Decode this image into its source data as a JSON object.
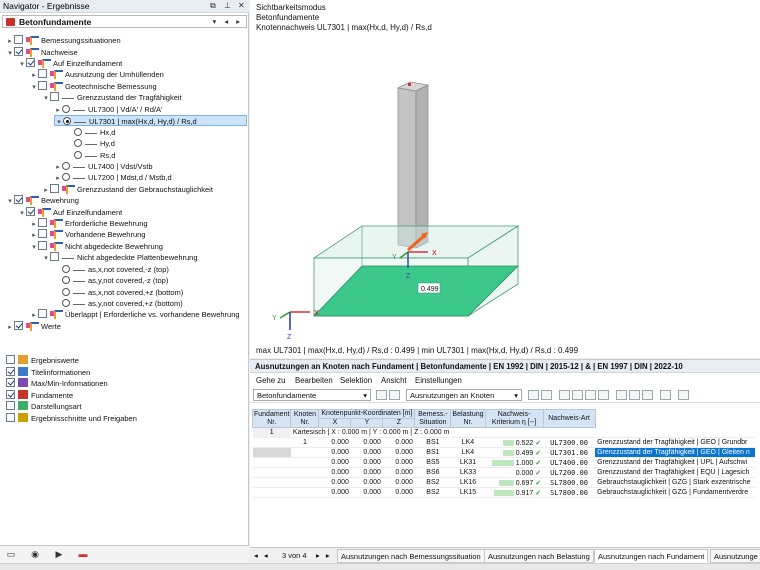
{
  "navigator": {
    "title": "Navigator - Ergebnisse",
    "combo": "Betonfundamente",
    "tree": [
      {
        "label": "Bemessungssituationen"
      },
      {
        "label": "Nachweise"
      },
      {
        "label": "Auf Einzelfundament"
      },
      {
        "label": "Ausnutzung der Umhüllenden"
      },
      {
        "label": "Geotechnische Bemessung"
      },
      {
        "label": "Grenzzustand der Tragfähigkeit"
      },
      {
        "label": "UL7300 | Vd/A' / Rd/A'"
      },
      {
        "label": "UL7301 | max(Hx,d, Hy,d) / Rs,d"
      },
      {
        "label": "Hx,d"
      },
      {
        "label": "Hy,d"
      },
      {
        "label": "Rs,d"
      },
      {
        "label": "UL7400 | Vdst/Vstb"
      },
      {
        "label": "UL7200 | Mdst,d / Mstb,d"
      },
      {
        "label": "Grenzzustand der Gebrauchstauglichkeit"
      },
      {
        "label": "Bewehrung"
      },
      {
        "label": "Auf Einzelfundament"
      },
      {
        "label": "Erforderliche Bewehrung"
      },
      {
        "label": "Vorhandene Bewehrung"
      },
      {
        "label": "Nicht abgedeckte Bewehrung"
      },
      {
        "label": "Nicht abgedeckte Plattenbewehrung"
      },
      {
        "label": "as,x,not covered,-z (top)"
      },
      {
        "label": "as,y,not covered,-z (top)"
      },
      {
        "label": "as,x,not covered,+z (bottom)"
      },
      {
        "label": "as,y,not covered,+z (bottom)"
      },
      {
        "label": "Überlappt | Erforderliche vs. vorhandene Bewehrung"
      },
      {
        "label": "Werte"
      }
    ],
    "bottom_tree": [
      {
        "label": "Ergebniswerte"
      },
      {
        "label": "Titelinformationen"
      },
      {
        "label": "Max/Min-Informationen"
      },
      {
        "label": "Fundamente"
      },
      {
        "label": "Darstellungsart"
      },
      {
        "label": "Ergebnisschnitte und Freigaben"
      }
    ]
  },
  "viewport": {
    "line1": "Sichtbarkeitsmodus",
    "line2": "Betonfundamente",
    "line3": "Knotennachweis UL7301 | max(Hx,d, Hy,d) / Rs,d",
    "value_label": "0.499",
    "axis_x": "X",
    "axis_y": "Y",
    "axis_z": "Z",
    "footer": "max UL7301 | max(Hx,d, Hy,d) / Rs,d : 0.499 | min UL7301 | max(Hx,d, Hy,d) / Rs,d : 0.499",
    "colors": {
      "footing_top": "#3cc88a",
      "footing_edge": "#4a9c7a",
      "column": "#c8c8c8"
    }
  },
  "results": {
    "title": "Ausnutzungen an Knoten nach Fundament | Betonfundamente | EN 1992 | DIN | 2015-12 | & | EN 1997 | DIN | 2022-10",
    "menu": [
      "Gehe zu",
      "Bearbeiten",
      "Selektion",
      "Ansicht",
      "Einstellungen"
    ],
    "combo1": "Betonfundamente",
    "combo2": "Ausnutzungen an Knoten",
    "headers": {
      "fundament": "Fundament Nr.",
      "knoten": "Knoten Nr.",
      "coords": "Knotenpunkt-Koordinaten [m]",
      "x": "X",
      "y": "Y",
      "z": "Z",
      "bemessung": "Bemess.-Situation",
      "belastung": "Belastung Nr.",
      "kriterium": "Nachweis-Kriterium η [--]",
      "art": "Nachweis-Art"
    },
    "group_label": "1",
    "group_text": "Kartesisch | X : 0.000 m | Y : 0.000 m | Z : 0.000 m",
    "rows": [
      {
        "knoten": "1",
        "x": "0.000",
        "y": "0.000",
        "z": "0.000",
        "bs": "BS1",
        "lk": "LK4",
        "eta": "0.522",
        "code": "UL7300.00",
        "art": "Grenzzustand der Tragfähigkeit | GEO | Grundbr"
      },
      {
        "knoten": "",
        "x": "0.000",
        "y": "0.000",
        "z": "0.000",
        "bs": "BS1",
        "lk": "LK4",
        "eta": "0.499",
        "code": "UL7301.00",
        "art": "Grenzzustand der Tragfähigkeit | GEO | Gleiten n"
      },
      {
        "knoten": "",
        "x": "0.000",
        "y": "0.000",
        "z": "0.000",
        "bs": "BS5",
        "lk": "LK31",
        "eta": "1.000",
        "code": "UL7400.00",
        "art": "Grenzzustand der Tragfähigkeit | UPL | Aufschwi"
      },
      {
        "knoten": "",
        "x": "0.000",
        "y": "0.000",
        "z": "0.000",
        "bs": "BS6",
        "lk": "LK33",
        "eta": "0.000",
        "code": "UL7200.00",
        "art": "Grenzzustand der Tragfähigkeit | EQU | Lagesich"
      },
      {
        "knoten": "",
        "x": "0.000",
        "y": "0.000",
        "z": "0.000",
        "bs": "BS2",
        "lk": "LK16",
        "eta": "0.697",
        "code": "SL7800.00",
        "art": "Gebrauchstauglichkeit | GZG | Stark exzentrische"
      },
      {
        "knoten": "",
        "x": "0.000",
        "y": "0.000",
        "z": "0.000",
        "bs": "BS2",
        "lk": "LK15",
        "eta": "0.917",
        "code": "SL7800.00",
        "art": "Gebrauchstauglichkeit | GZG | Fundamentverdre"
      }
    ],
    "pager": "3 von 4",
    "tabs": [
      "Ausnutzungen nach Bemessungssituation",
      "Ausnutzungen nach Belastung",
      "Ausnutzungen nach Fundament",
      "Ausnutzunge"
    ]
  }
}
